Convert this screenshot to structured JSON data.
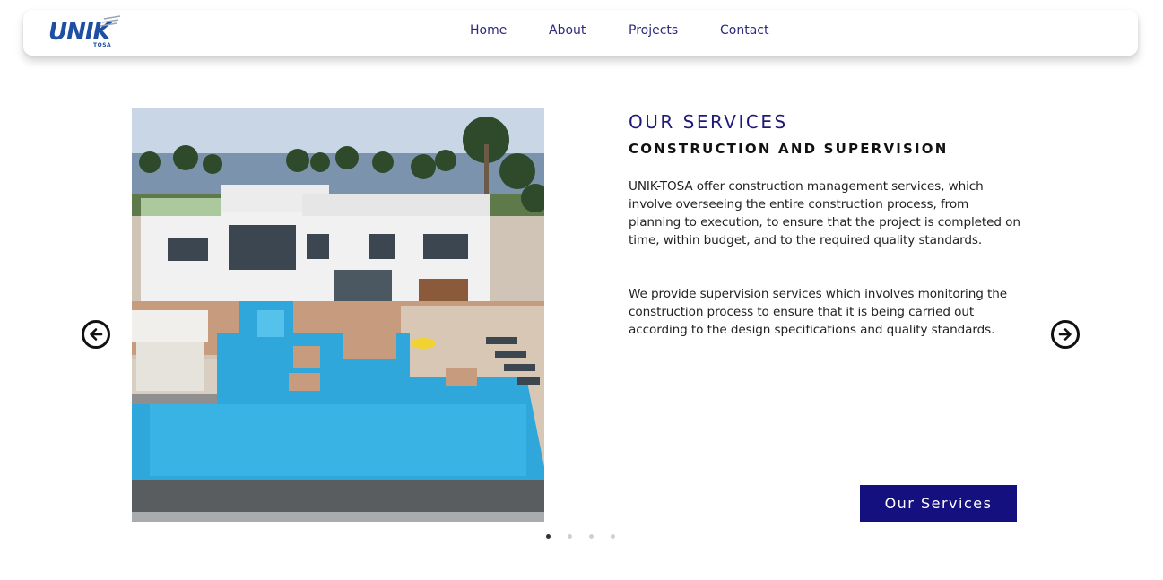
{
  "header": {
    "logo_text": "UNIK",
    "logo_sub": "TOSA",
    "nav": [
      {
        "label": "Home"
      },
      {
        "label": "About"
      },
      {
        "label": "Projects"
      },
      {
        "label": "Contact"
      }
    ]
  },
  "slide": {
    "title": "OUR SERVICES",
    "subtitle": "CONSTRUCTION AND SUPERVISION",
    "paragraphs": [
      "UNIK-TOSA offer construction management services, which involve overseeing the entire construction process, from planning to execution, to ensure that the project is completed on time, within budget, and to the required quality standards.",
      "We provide supervision services which involves monitoring the construction process to ensure that it is being carried out according to the design specifications and quality standards."
    ],
    "cta_label": "Our Services"
  },
  "carousel": {
    "dots": 4,
    "active_index": 0
  },
  "colors": {
    "brand_navy": "#15107f",
    "nav_text": "#2d2a7c",
    "logo_blue": "#1d4fa3"
  },
  "icons": {
    "prev": "arrow-left-circle-icon",
    "next": "arrow-right-circle-icon"
  }
}
